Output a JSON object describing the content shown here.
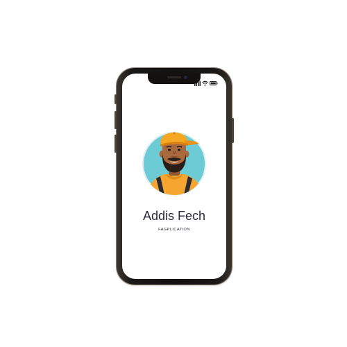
{
  "app": {
    "title": "Addis Fech",
    "subtitle": "FAGPLICATION"
  },
  "status_bar": {
    "icons": [
      "signal-icon",
      "wifi-icon",
      "battery-icon"
    ]
  },
  "avatar": {
    "icon": "worker-with-cap-avatar",
    "colors": {
      "background": "#6ccbd4",
      "cap": "#f5a623",
      "shirt": "#f7a531",
      "skin": "#a8693f",
      "beard": "#2a1e18"
    }
  },
  "colors": {
    "screen": "#ffffff",
    "phone_body": "#121110",
    "text": "#2c2a3a"
  }
}
